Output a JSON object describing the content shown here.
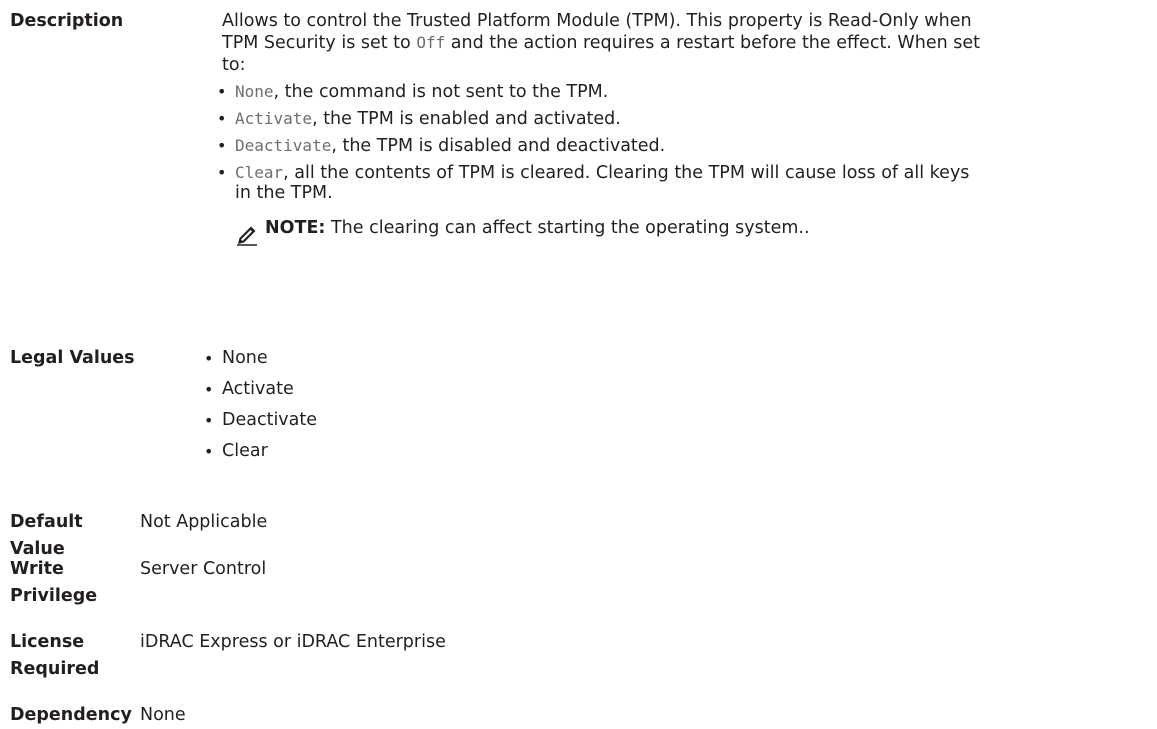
{
  "description": {
    "label": "Description",
    "intro_part1": "Allows to control the Trusted Platform Module (TPM). This property is Read-Only when",
    "intro_part2": "TPM Security is set to ",
    "intro_code": "Off",
    "intro_part3": " and the action requires a restart before the effect. When set",
    "intro_part4": "to:",
    "items": [
      {
        "code": "None",
        "text": ", the command is not sent to the TPM."
      },
      {
        "code": "Activate",
        "text": ", the TPM is enabled and activated."
      },
      {
        "code": "Deactivate",
        "text": ", the TPM is disabled and deactivated."
      },
      {
        "code": "Clear",
        "text": ", all the contents of TPM is cleared. Clearing the TPM will cause loss of all keys",
        "text2": "in the TPM."
      }
    ],
    "note_label": "NOTE:",
    "note_text": " The clearing can affect starting the operating system.."
  },
  "legal_values": {
    "label": "Legal Values",
    "items": [
      "None",
      "Activate",
      "Deactivate",
      "Clear"
    ]
  },
  "default_value": {
    "label": "Default Value",
    "value": "Not Applicable"
  },
  "write_privilege": {
    "label_line1": "Write",
    "label_line2": "Privilege",
    "value": "Server Control"
  },
  "license_required": {
    "label_line1": "License",
    "label_line2": "Required",
    "value": "iDRAC Express or iDRAC Enterprise"
  },
  "dependency": {
    "label": "Dependency",
    "value": "None"
  },
  "icons": {
    "note": "pencil-note-icon"
  }
}
